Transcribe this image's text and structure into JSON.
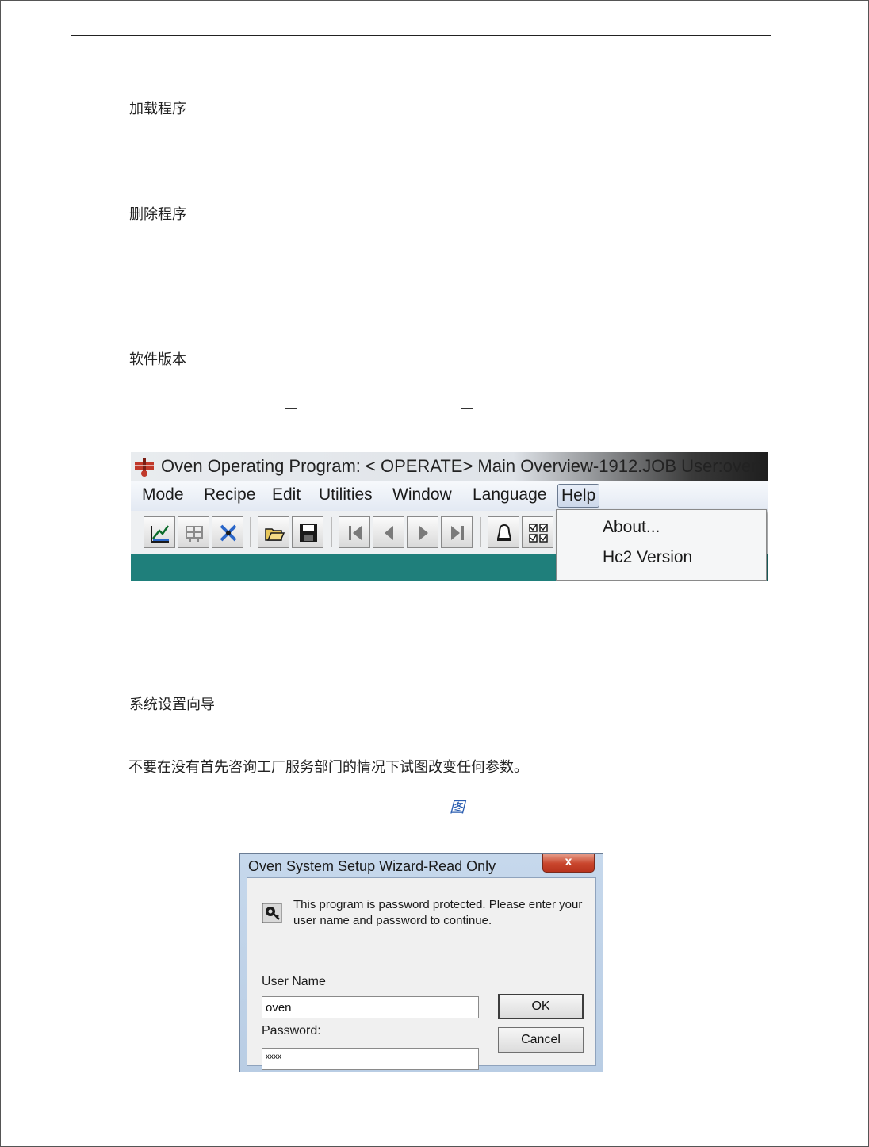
{
  "doc": {
    "headings": {
      "load_program": "加载程序",
      "delete_program": "删除程序",
      "software_version": "软件版本",
      "setup_wizard": "系统设置向导"
    },
    "warning": "不要在没有首先咨询工厂服务部门的情况下试图改变任何参数。",
    "figure_caption": "图"
  },
  "app_window": {
    "title": "Oven Operating Program: < OPERATE> Main Overview-1912.JOB User:oven",
    "menu": [
      "Mode",
      "Recipe",
      "Edit",
      "Utilities",
      "Window",
      "Language",
      "Help"
    ],
    "active_menu": "Help",
    "help_menu_items": [
      "About...",
      "Hc2 Version"
    ],
    "toolbar_icons": [
      "chart-icon",
      "oven-icon",
      "tools-icon",
      "open-folder-icon",
      "save-icon",
      "first-icon",
      "prev-icon",
      "next-icon",
      "last-icon",
      "alarm-bell-icon",
      "checklist-icon"
    ],
    "colors": {
      "workspace": "#1f7f7b",
      "menubar": "#e3e9f3"
    }
  },
  "login_dialog": {
    "title": "Oven System Setup Wizard-Read Only",
    "close_label": "x",
    "message": "This program is password protected.  Please enter your user name and password to continue.",
    "username_label": "User Name",
    "username_value": "oven",
    "password_label": "Password:",
    "password_value": "xxxx",
    "ok_label": "OK",
    "cancel_label": "Cancel"
  }
}
